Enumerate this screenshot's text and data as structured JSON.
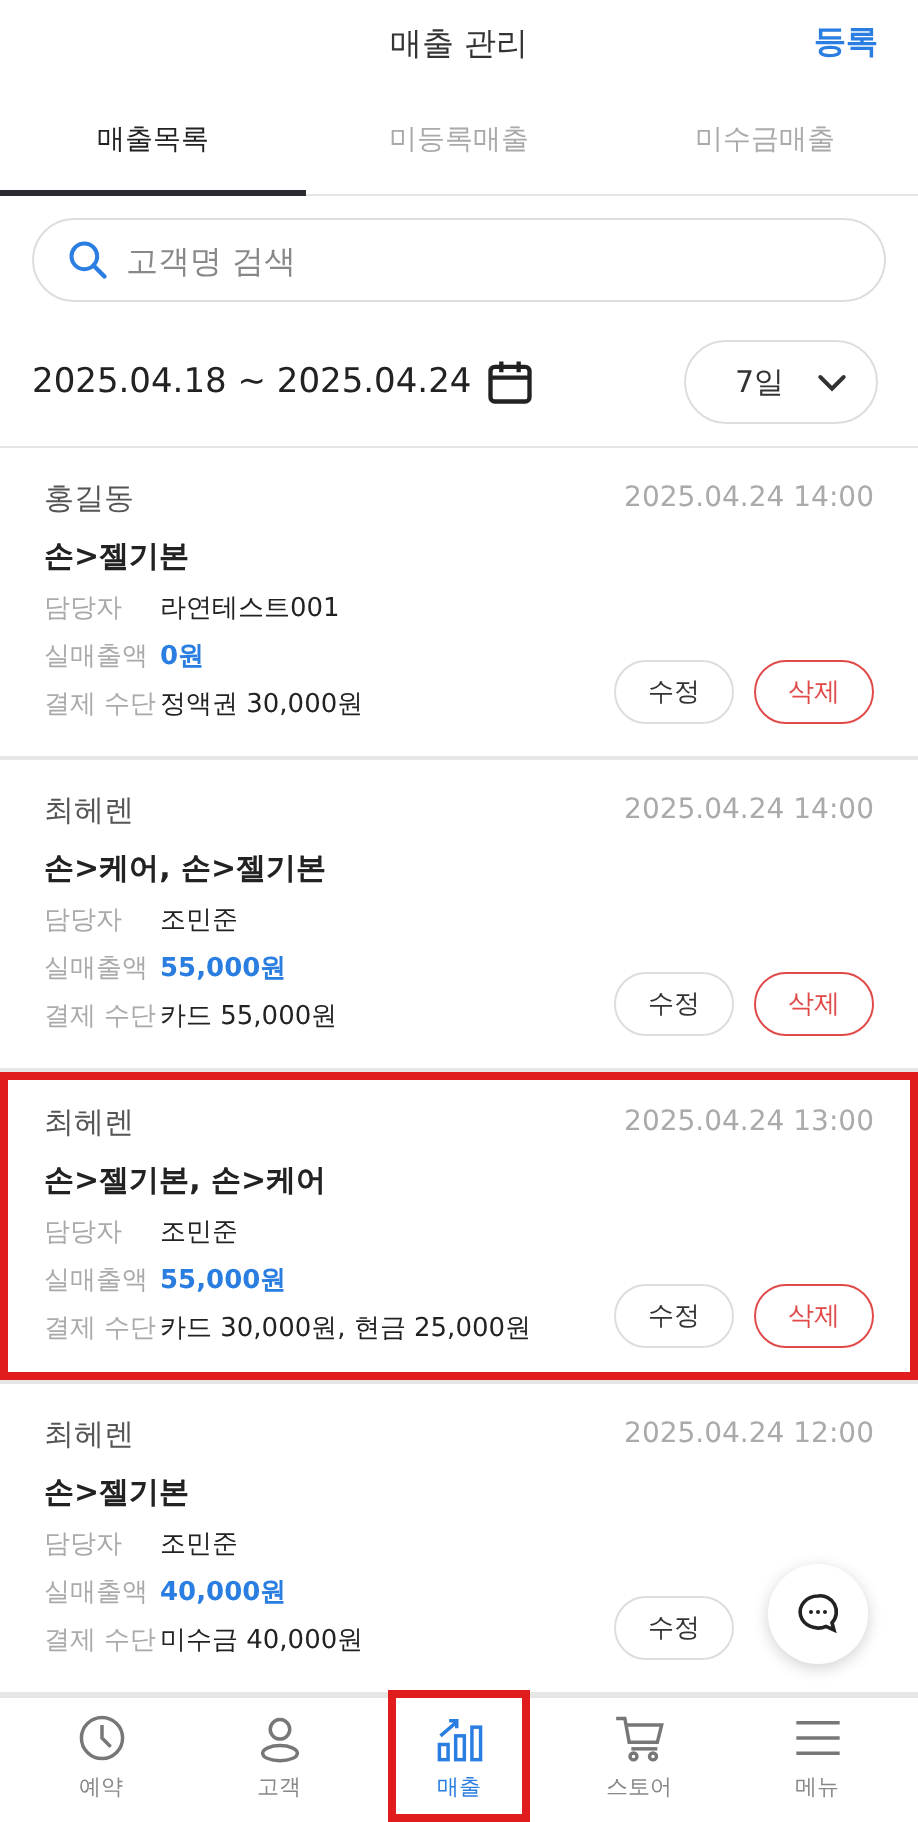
{
  "header": {
    "title": "매출 관리",
    "action": "등록"
  },
  "tabs": [
    {
      "label": "매출목록",
      "selected": true
    },
    {
      "label": "미등록매출",
      "selected": false
    },
    {
      "label": "미수금매출",
      "selected": false
    }
  ],
  "search": {
    "placeholder": "고객명 검색"
  },
  "date_range": {
    "text": "2025.04.18 ~ 2025.04.24",
    "period": "7일"
  },
  "sales": [
    {
      "customer": "홍길동",
      "datetime": "2025.04.24 14:00",
      "service": "손>젤기본",
      "staff_label": "담당자",
      "staff": "라연테스트001",
      "amount_label": "실매출액",
      "amount": "0원",
      "payment_label": "결제 수단",
      "payment": "정액권 30,000원",
      "edit_label": "수정",
      "delete_label": "삭제",
      "highlighted": false
    },
    {
      "customer": "최헤렌",
      "datetime": "2025.04.24 14:00",
      "service": "손>케어, 손>젤기본",
      "staff_label": "담당자",
      "staff": "조민준",
      "amount_label": "실매출액",
      "amount": "55,000원",
      "payment_label": "결제 수단",
      "payment": "카드 55,000원",
      "edit_label": "수정",
      "delete_label": "삭제",
      "highlighted": false
    },
    {
      "customer": "최헤렌",
      "datetime": "2025.04.24 13:00",
      "service": "손>젤기본, 손>케어",
      "staff_label": "담당자",
      "staff": "조민준",
      "amount_label": "실매출액",
      "amount": "55,000원",
      "payment_label": "결제 수단",
      "payment": "카드 30,000원, 현금 25,000원",
      "edit_label": "수정",
      "delete_label": "삭제",
      "highlighted": true
    },
    {
      "customer": "최헤렌",
      "datetime": "2025.04.24 12:00",
      "service": "손>젤기본",
      "staff_label": "담당자",
      "staff": "조민준",
      "amount_label": "실매출액",
      "amount": "40,000원",
      "payment_label": "결제 수단",
      "payment": "미수금 40,000원",
      "edit_label": "수정",
      "highlighted": false
    }
  ],
  "nav": [
    {
      "kind": "clock",
      "label": "예약",
      "selected": false,
      "highlighted": false
    },
    {
      "kind": "person",
      "label": "고객",
      "selected": false,
      "highlighted": false
    },
    {
      "kind": "chart",
      "label": "매출",
      "selected": true,
      "highlighted": true
    },
    {
      "kind": "cart",
      "label": "스토어",
      "selected": false,
      "highlighted": false
    },
    {
      "kind": "menu",
      "label": "메뉴",
      "selected": false,
      "highlighted": false
    }
  ]
}
